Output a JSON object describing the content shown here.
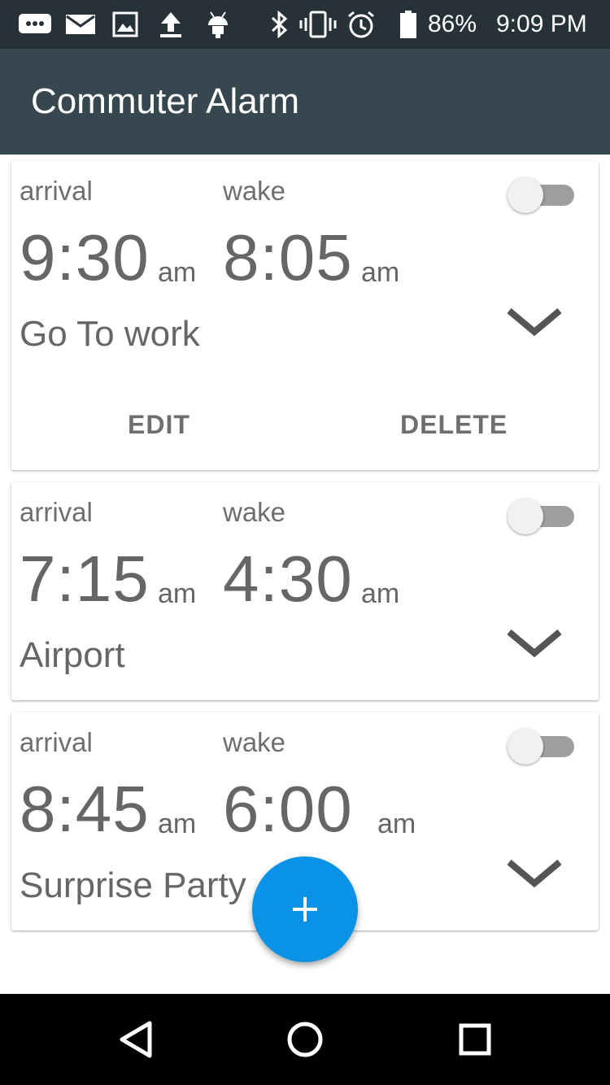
{
  "status_bar": {
    "battery_percent": "86%",
    "time": "9:09 PM",
    "icons": [
      "messages-icon",
      "mail-icon",
      "image-icon",
      "upload-icon",
      "android-icon",
      "bluetooth-icon",
      "vibrate-icon",
      "alarm-clock-icon",
      "battery-icon"
    ]
  },
  "app_bar": {
    "title": "Commuter Alarm"
  },
  "alarms": [
    {
      "arrival_label": "arrival",
      "arrival_time": "9:30",
      "arrival_period": "am",
      "wake_label": "wake",
      "wake_time": "8:05",
      "wake_period": "am",
      "name": "Go To work",
      "enabled": false,
      "expanded": true,
      "actions": {
        "edit": "EDIT",
        "delete": "DELETE"
      }
    },
    {
      "arrival_label": "arrival",
      "arrival_time": "7:15",
      "arrival_period": "am",
      "wake_label": "wake",
      "wake_time": "4:30",
      "wake_period": "am",
      "name": "Airport",
      "enabled": false,
      "expanded": false
    },
    {
      "arrival_label": "arrival",
      "arrival_time": "8:45",
      "arrival_period": "am",
      "wake_label": "wake",
      "wake_time": "6:00",
      "wake_period": "am",
      "name": "Surprise Party",
      "enabled": false,
      "expanded": false
    }
  ],
  "fab": {
    "icon": "plus-icon"
  },
  "nav_bar": {
    "icons": [
      "back-icon",
      "home-icon",
      "recents-icon"
    ]
  },
  "colors": {
    "status_bar": "#263238",
    "app_bar": "#37474f",
    "accent": "#0a93e6",
    "text_secondary": "#666666"
  }
}
